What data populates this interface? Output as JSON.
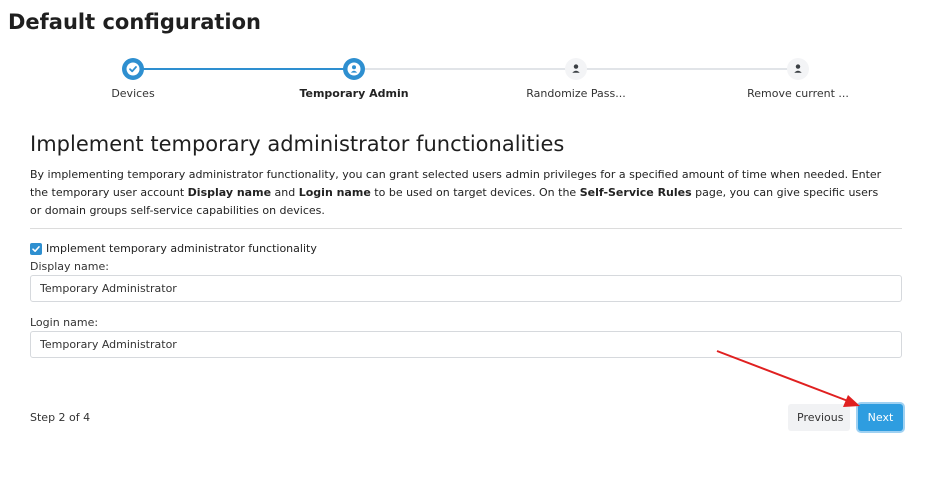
{
  "page": {
    "title": "Default configuration"
  },
  "stepper": {
    "steps": [
      {
        "label": "Devices",
        "state": "completed",
        "icon": "check-icon"
      },
      {
        "label": "Temporary Admin",
        "state": "current",
        "icon": "user-icon"
      },
      {
        "label": "Randomize Pass...",
        "state": "pending",
        "icon": "user-icon"
      },
      {
        "label": "Remove current ...",
        "state": "pending",
        "icon": "user-icon"
      }
    ]
  },
  "section": {
    "title": "Implement temporary administrator functionalities",
    "description": {
      "part1": "By implementing temporary administrator functionality, you can grant selected users admin privileges for a specified amount of time when needed. Enter the temporary user account ",
      "bold1": "Display name",
      "part2": " and ",
      "bold2": "Login name",
      "part3": " to be used on target devices. On the ",
      "bold3": "Self-Service Rules",
      "part4": " page, you can give specific users or domain groups self-service capabilities on devices."
    }
  },
  "form": {
    "checkbox": {
      "label": "Implement temporary administrator functionality",
      "checked": true
    },
    "display_name": {
      "label": "Display name:",
      "value": "Temporary Administrator"
    },
    "login_name": {
      "label": "Login name:",
      "value": "Temporary Administrator"
    }
  },
  "footer": {
    "step_indicator": "Step 2 of 4",
    "previous_label": "Previous",
    "next_label": "Next"
  },
  "colors": {
    "accent": "#2e8fd0",
    "primary_button": "#2e9de0",
    "annotation_arrow": "#e02020"
  }
}
